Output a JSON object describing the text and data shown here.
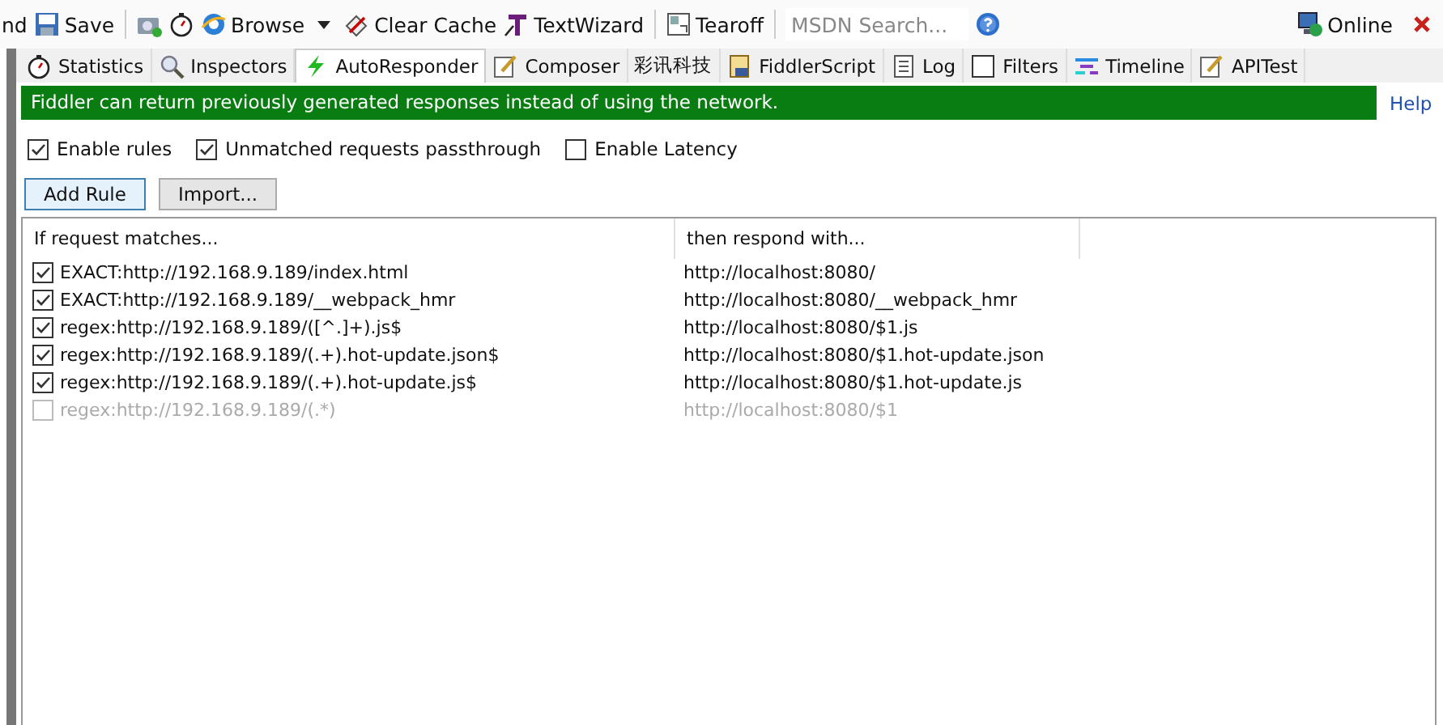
{
  "toolbar": {
    "items": [
      {
        "kind": "text",
        "label": "nd"
      },
      {
        "kind": "save",
        "label": "Save"
      },
      {
        "kind": "camera"
      },
      {
        "kind": "timer"
      },
      {
        "kind": "browse",
        "label": "Browse"
      },
      {
        "kind": "caret"
      },
      {
        "kind": "clear",
        "label": "Clear Cache"
      },
      {
        "kind": "wizard",
        "label": "TextWizard"
      },
      {
        "kind": "tearoff",
        "label": "Tearoff"
      },
      {
        "kind": "search",
        "placeholder": "MSDN Search..."
      },
      {
        "kind": "help"
      }
    ],
    "right": {
      "online": "Online"
    }
  },
  "tabs": [
    {
      "label": "Statistics",
      "selected": false
    },
    {
      "label": "Inspectors",
      "selected": false
    },
    {
      "label": "AutoResponder",
      "selected": true
    },
    {
      "label": "Composer",
      "selected": false
    },
    {
      "label": "彩讯科技",
      "selected": false
    },
    {
      "label": "FiddlerScript",
      "selected": false
    },
    {
      "label": "Log",
      "selected": false
    },
    {
      "label": "Filters",
      "selected": false
    },
    {
      "label": "Timeline",
      "selected": false
    },
    {
      "label": "APITest",
      "selected": false
    }
  ],
  "banner": {
    "text": "Fiddler can return previously generated responses instead of using the network.",
    "help": "Help"
  },
  "options": [
    {
      "label": "Enable rules",
      "checked": true
    },
    {
      "label": "Unmatched requests passthrough",
      "checked": true
    },
    {
      "label": "Enable Latency",
      "checked": false
    }
  ],
  "buttons": [
    {
      "label": "Add Rule",
      "selected": true
    },
    {
      "label": "Import...",
      "selected": false
    }
  ],
  "table": {
    "columns": [
      "If request matches...",
      "then respond with..."
    ],
    "rows": [
      {
        "checked": true,
        "match": "EXACT:http://192.168.9.189/index.html",
        "respond": "http://localhost:8080/"
      },
      {
        "checked": true,
        "match": "EXACT:http://192.168.9.189/__webpack_hmr",
        "respond": "http://localhost:8080/__webpack_hmr"
      },
      {
        "checked": true,
        "match": "regex:http://192.168.9.189/([^.]+).js$",
        "respond": "http://localhost:8080/$1.js"
      },
      {
        "checked": true,
        "match": "regex:http://192.168.9.189/(.+).hot-update.json$",
        "respond": "http://localhost:8080/$1.hot-update.json"
      },
      {
        "checked": true,
        "match": "regex:http://192.168.9.189/(.+).hot-update.js$",
        "respond": "http://localhost:8080/$1.hot-update.js"
      },
      {
        "checked": false,
        "match": "regex:http://192.168.9.189/(.*)",
        "respond": "http://localhost:8080/$1"
      }
    ]
  }
}
